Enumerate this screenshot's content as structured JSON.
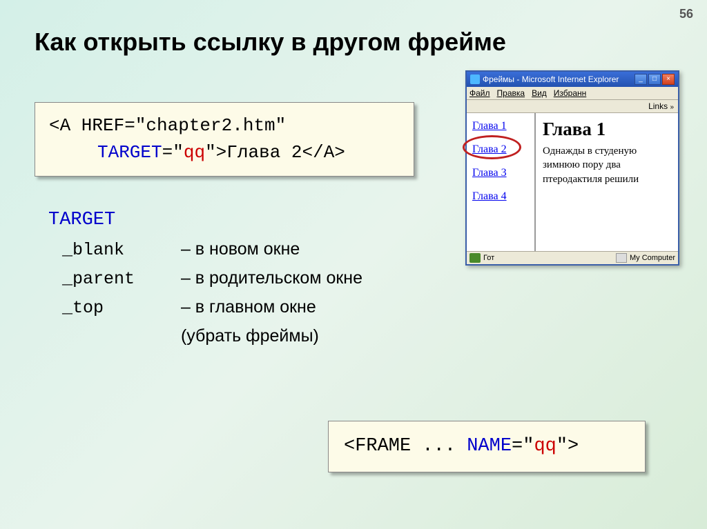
{
  "page_number": "56",
  "title": "Как открыть ссылку в другом фрейме",
  "code_top": {
    "line1_prefix": "<A HREF=\"chapter2.htm\"",
    "line2_target": "TARGET",
    "line2_eq": "=\"",
    "line2_val": "qq",
    "line2_close": "\">",
    "line2_text": "Глава 2",
    "line2_end": "</A>"
  },
  "target_section": {
    "header": "TARGET",
    "blank": "_blank",
    "blank_desc": "– в новом окне",
    "parent": "_parent",
    "parent_desc": "– в родительском окне",
    "top": "_top",
    "top_desc": "– в главном окне",
    "top_desc2": "(убрать фреймы)"
  },
  "code_bottom": {
    "frame": "<FRAME ... ",
    "name": "NAME",
    "eq": "=\"",
    "val": "qq",
    "close": "\">"
  },
  "browser": {
    "title": "Фреймы - Microsoft Internet Explorer",
    "menu": {
      "file": "Файл",
      "edit": "Правка",
      "view": "Вид",
      "fav": "Избранн"
    },
    "links_label": "Links",
    "chapters": [
      "Глава 1",
      "Глава 2",
      "Глава 3",
      "Глава 4"
    ],
    "content_heading": "Глава 1",
    "content_text": "Однажды в студеную зимнюю пору два птеродактиля решили",
    "status_go": "Гот",
    "status_comp": "My Computer"
  },
  "win_buttons": {
    "min": "_",
    "max": "□",
    "close": "×"
  }
}
